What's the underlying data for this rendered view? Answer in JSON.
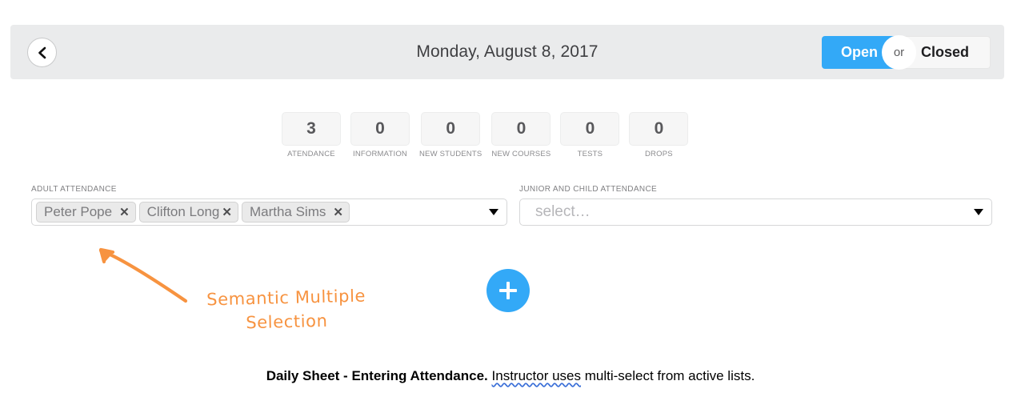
{
  "header": {
    "back_icon": "chevron-left-icon",
    "title": "Monday, August 8, 2017",
    "toggle": {
      "open_label": "Open",
      "or_label": "or",
      "closed_label": "Closed",
      "active": "Open",
      "active_color": "#33a9f7"
    }
  },
  "counters": [
    {
      "value": "3",
      "label": "ATENDANCE"
    },
    {
      "value": "0",
      "label": "INFORMATION"
    },
    {
      "value": "0",
      "label": "NEW STUDENTS"
    },
    {
      "value": "0",
      "label": "NEW COURSES"
    },
    {
      "value": "0",
      "label": "TESTS"
    },
    {
      "value": "0",
      "label": "DROPS"
    }
  ],
  "fields": {
    "adult": {
      "label": "ADULT ATTENDANCE",
      "chips": [
        {
          "name": "Peter Pope",
          "remove_icon": "close-icon"
        },
        {
          "name": "Clifton Long",
          "remove_icon": "close-icon"
        },
        {
          "name": "Martha Sims",
          "remove_icon": "close-icon"
        }
      ],
      "caret_icon": "chevron-down-icon"
    },
    "junior": {
      "label": "JUNIOR AND CHILD ATTENDANCE",
      "placeholder": "select…",
      "value": "",
      "caret_icon": "chevron-down-icon"
    }
  },
  "add_button": {
    "icon": "plus-icon",
    "color": "#33a9f7"
  },
  "annotation": {
    "text_line1": "Semantic Multiple",
    "text_line2": "Selection",
    "color": "#f79340"
  },
  "caption": {
    "bold": "Daily Sheet - Entering Attendance.",
    "spellchecked": "Instructor uses",
    "rest": "multi-select from active lists."
  }
}
